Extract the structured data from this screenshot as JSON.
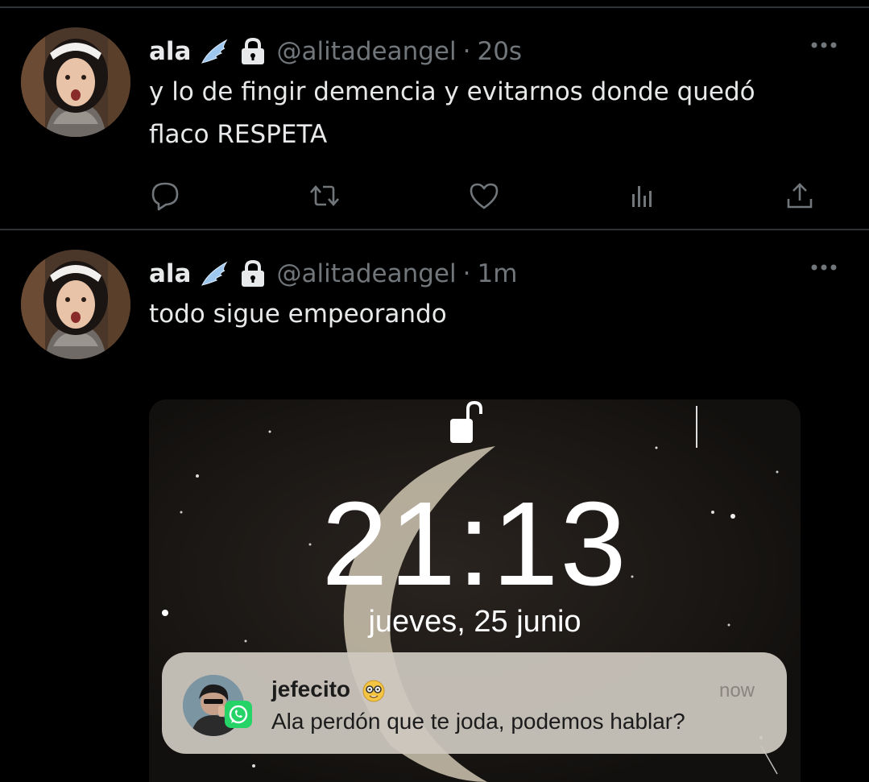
{
  "tweets": [
    {
      "name": "ala",
      "handle": "@alitadeangel",
      "separator": "·",
      "time": "20s",
      "text_line1": "y lo de fingir demencia y evitarnos donde quedó",
      "text_line2": "flaco RESPETA",
      "icons": [
        "reply-icon",
        "retweet-icon",
        "like-icon",
        "analytics-icon",
        "share-icon"
      ]
    },
    {
      "name": "ala",
      "handle": "@alitadeangel",
      "separator": "·",
      "time": "1m",
      "text_line1": "todo sigue empeorando"
    }
  ],
  "lockscreen": {
    "time": "21:13",
    "date": "jueves, 25 junio",
    "notification": {
      "sender": "jefecito",
      "sender_emoji": "nerd-face-emoji",
      "time": "now",
      "message": "Ala perdón que te joda, podemos hablar?",
      "app_icon": "whatsapp-icon"
    }
  },
  "colors": {
    "background": "#000000",
    "text": "#e7e9ea",
    "muted": "#71767b",
    "divider": "#2f3336",
    "wing_badge": "#9ec7f0"
  }
}
